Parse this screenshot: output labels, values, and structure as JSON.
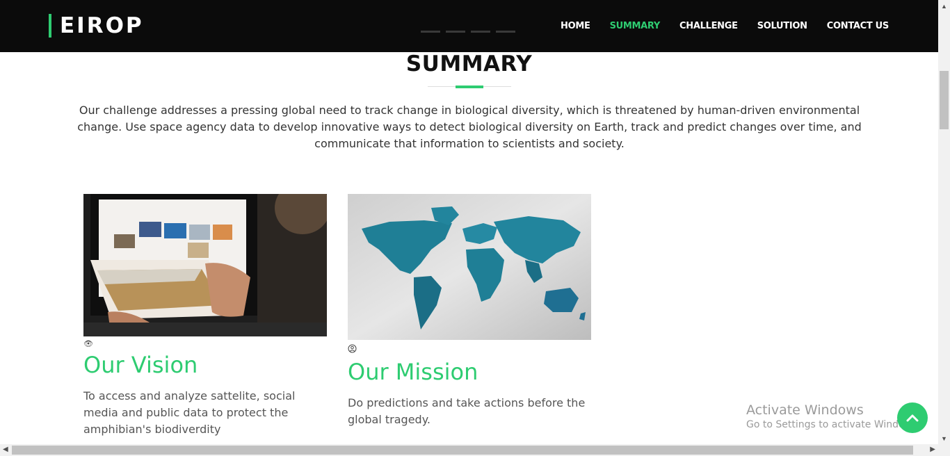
{
  "brand": {
    "name": "EIROP"
  },
  "nav": {
    "items": [
      {
        "label": "HOME",
        "active": false
      },
      {
        "label": "SUMMARY",
        "active": true
      },
      {
        "label": "CHALLENGE",
        "active": false
      },
      {
        "label": "SOLUTION",
        "active": false
      },
      {
        "label": "CONTACT US",
        "active": false
      }
    ]
  },
  "section": {
    "title": "SUMMARY",
    "text": "Our challenge addresses a pressing global need to track change in biological diversity, which is threatened by human-driven environmental change. Use space agency data to develop innovative ways to detect biological diversity on Earth, track and predict changes over time, and communicate that information to scientists and society."
  },
  "cards": [
    {
      "icon": "eye-icon",
      "title": "Our Vision",
      "text": "To access and analyze sattelite, social media and public data to protect the amphibian's biodiverdity"
    },
    {
      "icon": "user-circle-icon",
      "title": "Our Mission",
      "text": "Do predictions and take actions before the global tragedy."
    }
  ],
  "watermark": {
    "line1": "Activate Windows",
    "line2": "Go to Settings to activate Windows."
  },
  "colors": {
    "accent": "#2ecc71",
    "header_bg": "#0b0b0b",
    "map_blue": "#1f7f96"
  }
}
